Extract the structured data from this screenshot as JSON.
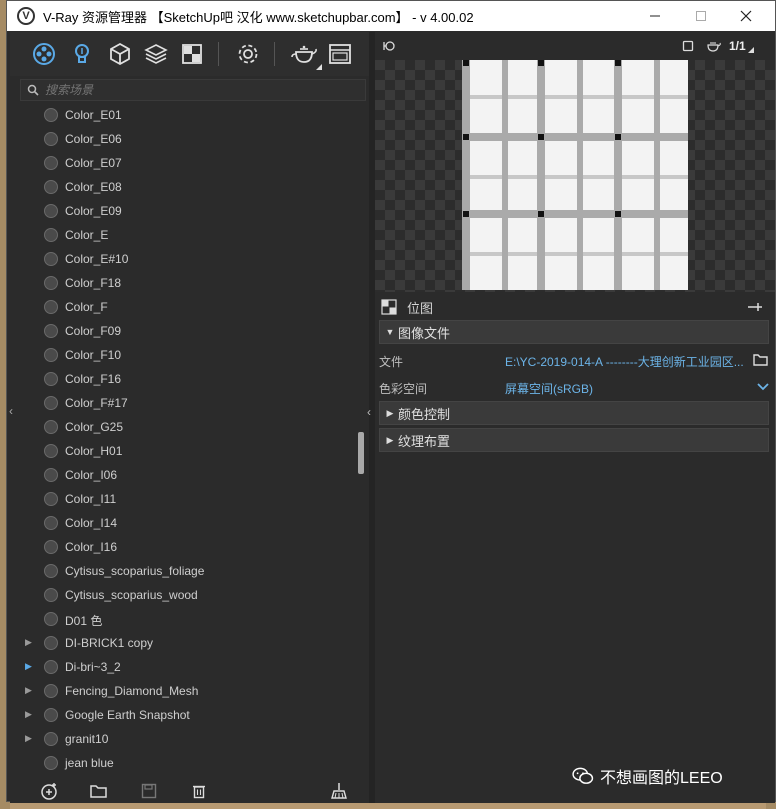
{
  "window": {
    "title": "V-Ray 资源管理器 【SketchUp吧 汉化 www.sketchupbar.com】 - v 4.00.02",
    "logo_icon": "vray-logo-icon",
    "minimize_icon": "minimize-icon",
    "maximize_icon": "maximize-icon",
    "close_icon": "close-icon"
  },
  "toolbar": {
    "icons": [
      "materials-icon",
      "lights-icon",
      "geometry-icon",
      "layers-icon",
      "textures-icon",
      "settings-icon",
      "render-teapot-icon",
      "frame-buffer-icon"
    ]
  },
  "search": {
    "placeholder": "搜索场景"
  },
  "assets": {
    "items": [
      {
        "label": "Color_E01",
        "expandable": false
      },
      {
        "label": "Color_E06",
        "expandable": false
      },
      {
        "label": "Color_E07",
        "expandable": false
      },
      {
        "label": "Color_E08",
        "expandable": false
      },
      {
        "label": "Color_E09",
        "expandable": false
      },
      {
        "label": "Color_E",
        "expandable": false
      },
      {
        "label": "Color_E#10",
        "expandable": false
      },
      {
        "label": "Color_F18",
        "expandable": false
      },
      {
        "label": "Color_F",
        "expandable": false
      },
      {
        "label": "Color_F09",
        "expandable": false
      },
      {
        "label": "Color_F10",
        "expandable": false
      },
      {
        "label": "Color_F16",
        "expandable": false
      },
      {
        "label": "Color_F#17",
        "expandable": false
      },
      {
        "label": "Color_G25",
        "expandable": false
      },
      {
        "label": "Color_H01",
        "expandable": false
      },
      {
        "label": "Color_I06",
        "expandable": false
      },
      {
        "label": "Color_I11",
        "expandable": false
      },
      {
        "label": "Color_I14",
        "expandable": false
      },
      {
        "label": "Color_I16",
        "expandable": false
      },
      {
        "label": "Cytisus_scoparius_foliage",
        "expandable": false
      },
      {
        "label": "Cytisus_scoparius_wood",
        "expandable": false
      },
      {
        "label": "D01 色",
        "expandable": false
      },
      {
        "label": "DI-BRICK1 copy",
        "expandable": true,
        "active": false
      },
      {
        "label": "Di-bri~3_2",
        "expandable": true,
        "active": true
      },
      {
        "label": "Fencing_Diamond_Mesh",
        "expandable": true,
        "active": false
      },
      {
        "label": "Google Earth Snapshot",
        "expandable": true,
        "active": false
      },
      {
        "label": "granit10",
        "expandable": true,
        "active": false
      },
      {
        "label": "jean blue",
        "expandable": false
      }
    ]
  },
  "bottom_toolbar": {
    "icons": [
      "add-material-icon",
      "open-file-icon",
      "save-icon",
      "delete-icon",
      "purge-icon"
    ]
  },
  "preview": {
    "header_icons": [
      "preview-mode-icon",
      "preview-shape-icon",
      "teapot-icon",
      "page-indicator-icon"
    ],
    "page_indicator": "1/1"
  },
  "properties": {
    "header_label": "位图",
    "sections": [
      {
        "label": "图像文件",
        "expanded": true
      },
      {
        "label": "颜色控制",
        "expanded": false
      },
      {
        "label": "纹理布置",
        "expanded": false
      }
    ],
    "file_label": "文件",
    "file_value": "E:\\YC-2019-014-A --------大理创新工业园区...",
    "color_space_label": "色彩空间",
    "color_space_value": "屏幕空间(sRGB)"
  },
  "watermark": {
    "text": "不想画图的LEEO"
  },
  "colors": {
    "panel_bg": "#2b2b2b",
    "accent_blue": "#6cb4e8",
    "title_bar_bg": "#ffffff"
  }
}
